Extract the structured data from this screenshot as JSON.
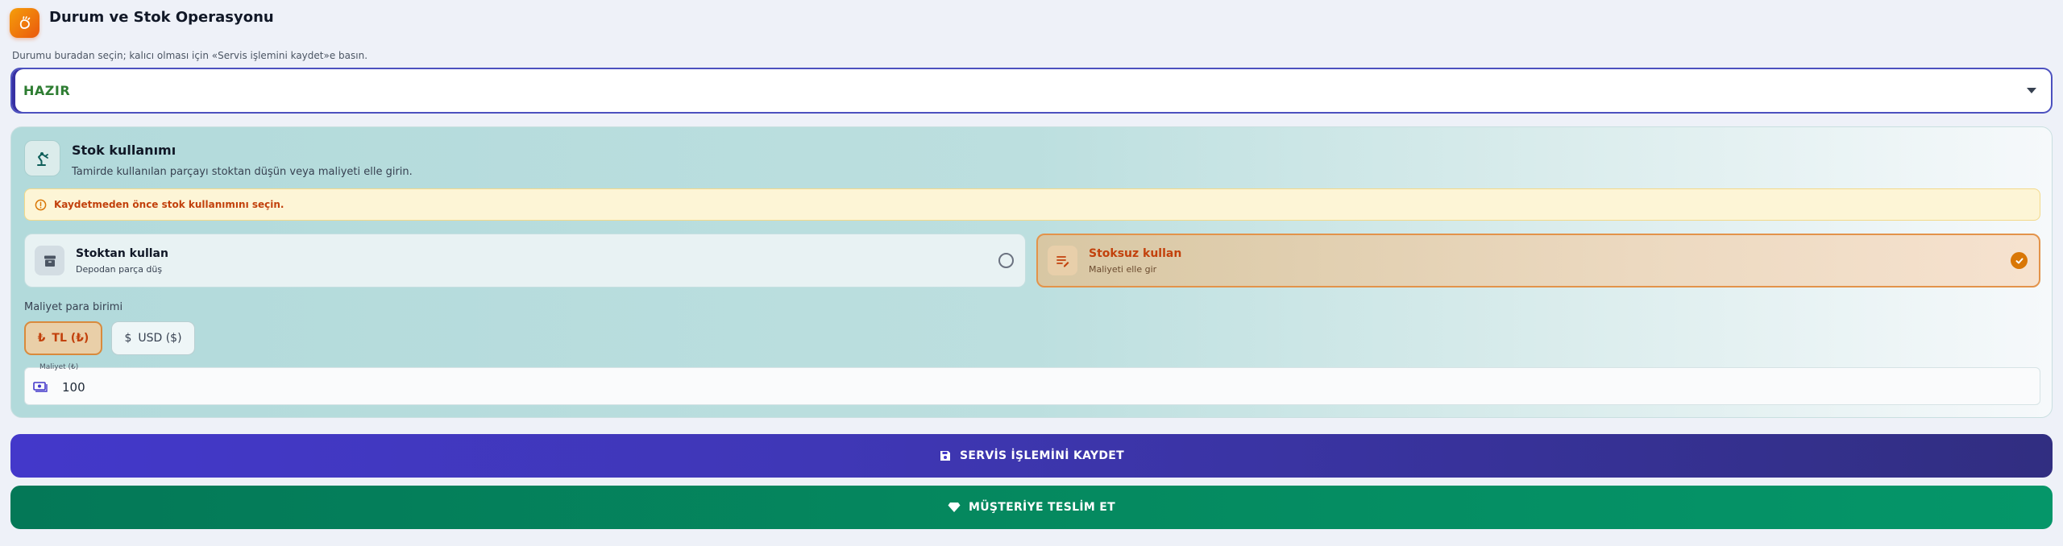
{
  "header": {
    "title": "Durum ve Stok Operasyonu",
    "logo_icon": "hand-sparkle-icon",
    "accent": "#ea580c"
  },
  "status": {
    "hint": "Durumu buradan seçin; kalıcı olması için «Servis işlemini kaydet»e basın.",
    "selected": "HAZIR",
    "selected_color": "#2e7d32"
  },
  "stock": {
    "title": "Stok kullanımı",
    "subtitle": "Tamirde kullanılan parçayı stoktan düşün veya maliyeti elle girin.",
    "warning": "Kaydetmeden önce stok kullanımını seçin.",
    "options": [
      {
        "title": "Stoktan kullan",
        "subtitle": "Depodan parça düş",
        "icon": "archive-box-icon",
        "selected": false
      },
      {
        "title": "Stoksuz kullan",
        "subtitle": "Maliyeti elle gir",
        "icon": "edit-list-icon",
        "selected": true
      }
    ],
    "currency_label": "Maliyet para birimi",
    "currencies": [
      {
        "label": "TL (₺)",
        "symbol": "₺",
        "selected": true
      },
      {
        "label": "USD ($)",
        "symbol": "$",
        "selected": false
      }
    ],
    "cost_label": "Maliyet (₺)",
    "cost_value": "100"
  },
  "actions": {
    "save_label": "SERVİS İŞLEMİNİ KAYDET",
    "save_color": "#4338ca",
    "deliver_label": "MÜŞTERİYE TESLİM ET",
    "deliver_color": "#047857"
  }
}
